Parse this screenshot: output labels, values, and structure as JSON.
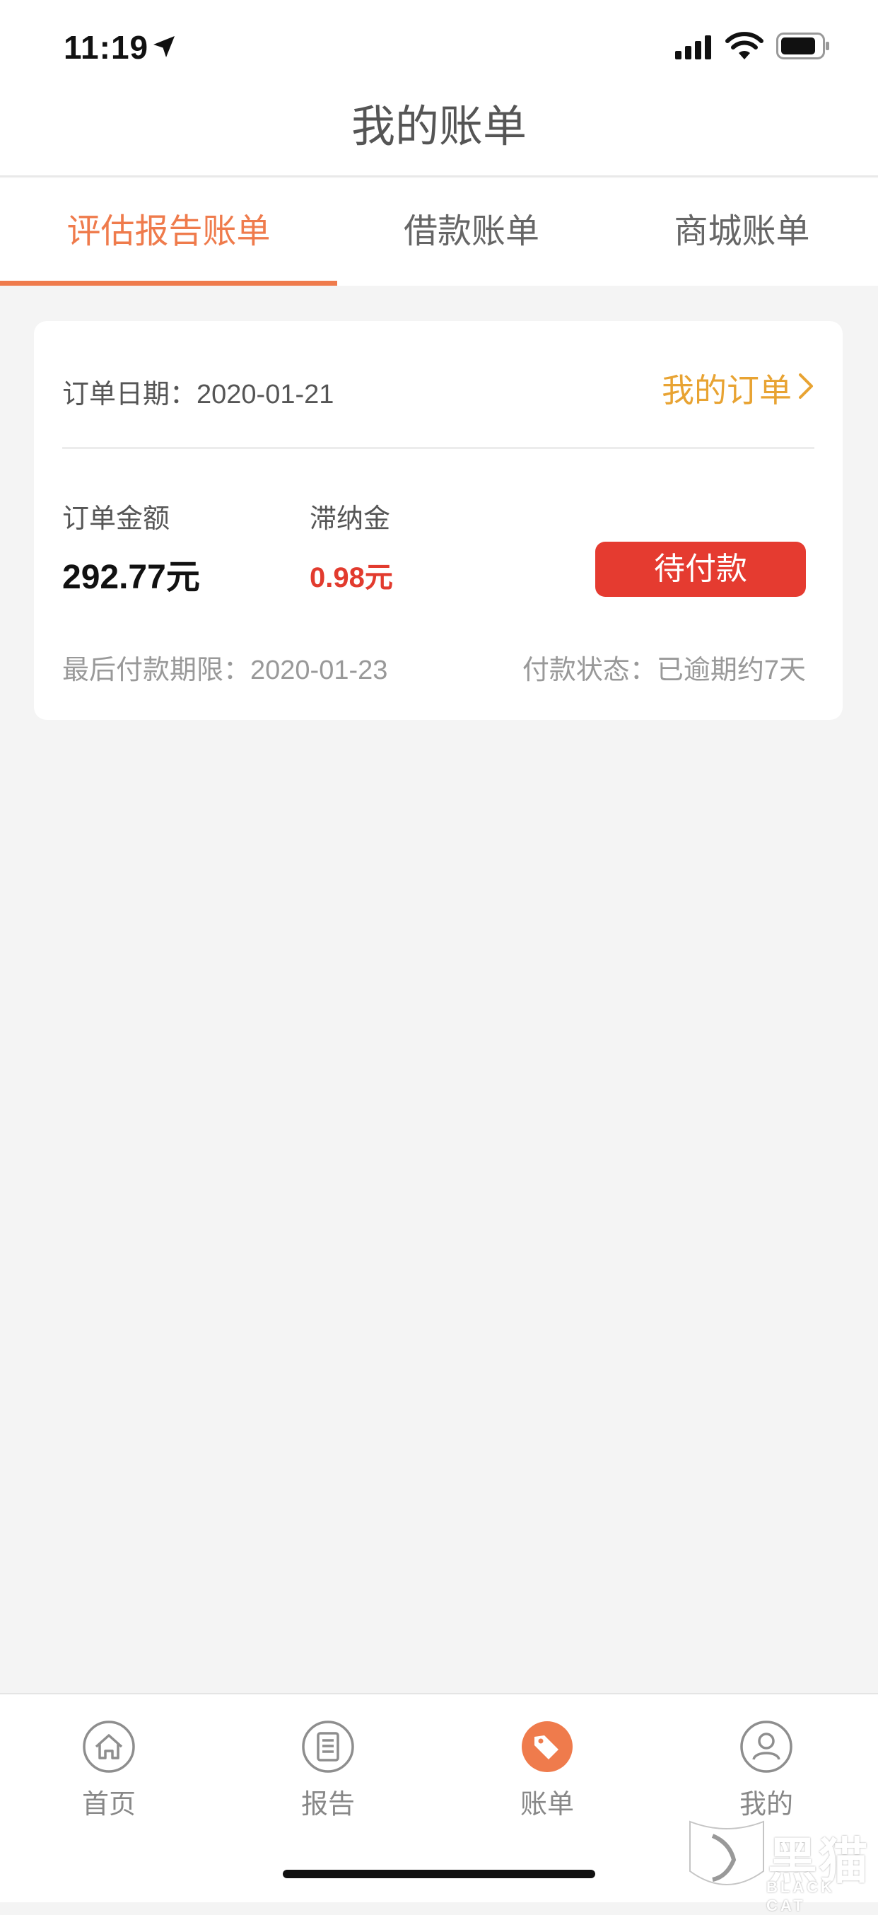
{
  "status_bar": {
    "time": "11:19"
  },
  "header": {
    "title": "我的账单"
  },
  "tabs": [
    {
      "label": "评估报告账单",
      "active": true
    },
    {
      "label": "借款账单",
      "active": false
    },
    {
      "label": "商城账单",
      "active": false
    }
  ],
  "bill": {
    "order_date": "订单日期：2020-01-21",
    "my_orders_link": "我的订单",
    "amount_label": "订单金额",
    "amount_value": "292.77元",
    "late_fee_label": "滞纳金",
    "late_fee_value": "0.98元",
    "pay_button": "待付款",
    "deadline": "最后付款期限：2020-01-23",
    "status": "付款状态：已逾期约7天"
  },
  "bottom_nav": [
    {
      "label": "首页",
      "icon": "home-icon"
    },
    {
      "label": "报告",
      "icon": "report-icon"
    },
    {
      "label": "账单",
      "icon": "bill-tag-icon",
      "active": true
    },
    {
      "label": "我的",
      "icon": "profile-icon"
    }
  ],
  "watermark": {
    "text": "黑猫",
    "sub": "BLACK CAT"
  },
  "colors": {
    "accent": "#ef7b4c",
    "link": "#e8a332",
    "danger": "#e53b30"
  }
}
